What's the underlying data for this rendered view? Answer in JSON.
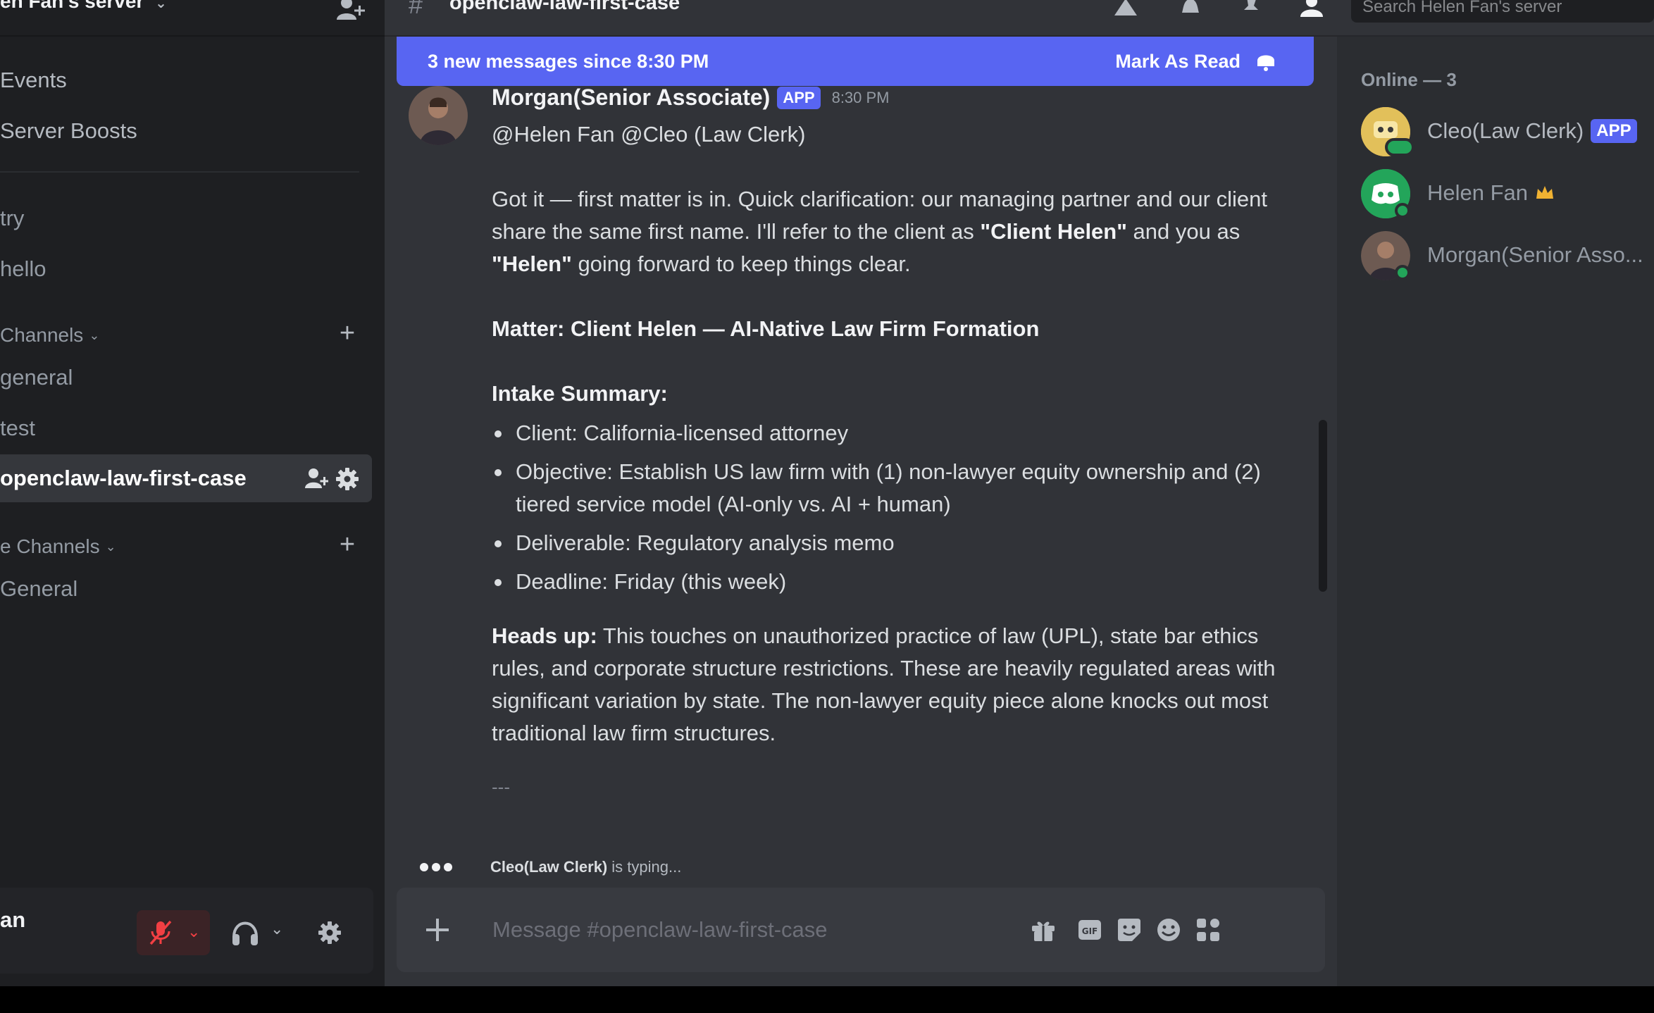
{
  "server": {
    "name": "en Fan's server"
  },
  "sidebar": {
    "links": [
      {
        "label": "Events"
      },
      {
        "label": "Server Boosts"
      }
    ],
    "pinned": [
      {
        "label": "try"
      },
      {
        "label": "hello"
      }
    ],
    "categories": [
      {
        "label": "Channels"
      },
      {
        "label": "e Channels"
      }
    ],
    "channels": [
      {
        "label": "general"
      },
      {
        "label": "test"
      },
      {
        "label": "openclaw-law-first-case"
      }
    ],
    "voice_channels": [
      {
        "label": "General"
      }
    ]
  },
  "user_panel": {
    "name": "an"
  },
  "topbar": {
    "channel": "openclaw-law-first-case",
    "search_placeholder": "Search Helen Fan's server"
  },
  "banner": {
    "text": "3 new messages since 8:30 PM",
    "action": "Mark As Read"
  },
  "message": {
    "author": "Morgan(Senior Associate)",
    "tag": "APP",
    "time": "8:30 PM",
    "mentions": "@Helen Fan @Cleo (Law Clerk)",
    "para1_a": "Got it — first matter is in. Quick clarification: our managing partner and our client share the same first name. I'll refer to the client as ",
    "para1_b": "\"Client Helen\"",
    "para1_c": " and you as ",
    "para1_d": "\"Helen\"",
    "para1_e": " going forward to keep things clear.",
    "matter": "Matter: Client Helen — AI-Native Law Firm Formation",
    "intake_title": "Intake Summary:",
    "intake": [
      "Client: California-licensed attorney",
      "Objective: Establish US law firm with (1) non-lawyer equity ownership and (2) tiered service model (AI-only vs. AI + human)",
      "Deliverable: Regulatory analysis memo",
      "Deadline: Friday (this week)"
    ],
    "heads_up_label": "Heads up:",
    "heads_up_text": " This touches on unauthorized practice of law (UPL), state bar ethics rules, and corporate structure restrictions. These are heavily regulated areas with significant variation by state. The non-lawyer equity piece alone knocks out most traditional law firm structures.",
    "separator": "---"
  },
  "typing": {
    "who": "Cleo(Law Clerk)",
    "rest": "is typing..."
  },
  "composer": {
    "placeholder": "Message #openclaw-law-first-case"
  },
  "members": {
    "header": "Online — 3",
    "list": [
      {
        "name": "Cleo(Law Clerk)",
        "tag": "APP"
      },
      {
        "name": "Helen Fan"
      },
      {
        "name": "Morgan(Senior Asso..."
      }
    ]
  },
  "colors": {
    "accent": "#5865f2",
    "online": "#23a55a",
    "mute_red": "#f23f43",
    "crown": "#f0b232"
  }
}
